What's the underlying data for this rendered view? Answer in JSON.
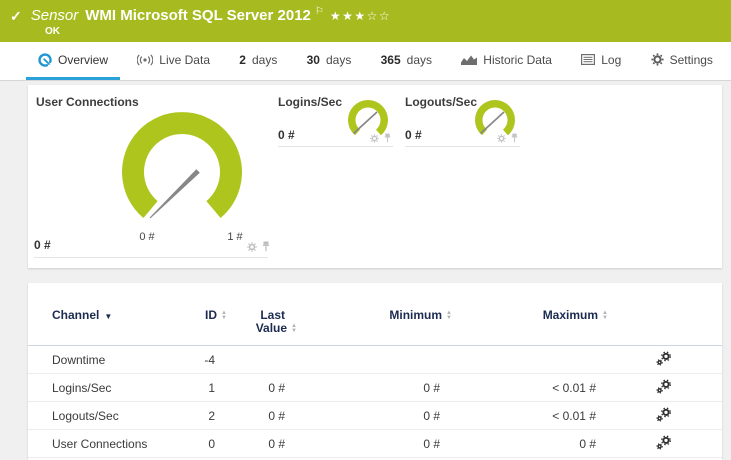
{
  "sensor_header": {
    "status_ok_color": "#a7bb21",
    "type_label": "Sensor",
    "name": "WMI Microsoft SQL Server 2012",
    "status": "OK",
    "rating": "★★★☆☆",
    "rating_filled": 3,
    "rating_total": 5
  },
  "icons": {
    "check": "✓",
    "flag": "⚐",
    "sort_asc": "▲",
    "sort_desc": "▼",
    "sorted_desc": "▼"
  },
  "tabs": {
    "overview": "Overview",
    "live_data": "Live Data",
    "d2_num": "2",
    "d2_label": "days",
    "d30_num": "30",
    "d30_label": "days",
    "d365_num": "365",
    "d365_label": "days",
    "historic": "Historic Data",
    "log": "Log",
    "settings": "Settings",
    "active_tab": "Overview"
  },
  "gauges": {
    "primary": {
      "title": "User Connections",
      "value": "0 #",
      "scale_min": "0 #",
      "scale_max": "1 #"
    },
    "logins": {
      "title": "Logins/Sec",
      "value": "0 #"
    },
    "logouts": {
      "title": "Logouts/Sec",
      "value": "0 #"
    }
  },
  "channel_table": {
    "headers": {
      "channel": "Channel",
      "id": "ID",
      "last_value_line1": "Last",
      "last_value_line2": "Value",
      "minimum": "Minimum",
      "maximum": "Maximum"
    },
    "rows": [
      {
        "channel": "Downtime",
        "id": "-4",
        "last": "",
        "min": "",
        "max": ""
      },
      {
        "channel": "Logins/Sec",
        "id": "1",
        "last": "0 #",
        "min": "0 #",
        "max": "< 0.01 #"
      },
      {
        "channel": "Logouts/Sec",
        "id": "2",
        "last": "0 #",
        "min": "0 #",
        "max": "< 0.01 #"
      },
      {
        "channel": "User Connections",
        "id": "0",
        "last": "0 #",
        "min": "0 #",
        "max": "0 #"
      }
    ]
  },
  "colors": {
    "brand_green": "#a7bb21",
    "gauge_green": "#aec51d",
    "accent_blue": "#2ba1da",
    "header_navy": "#1c2b50"
  }
}
